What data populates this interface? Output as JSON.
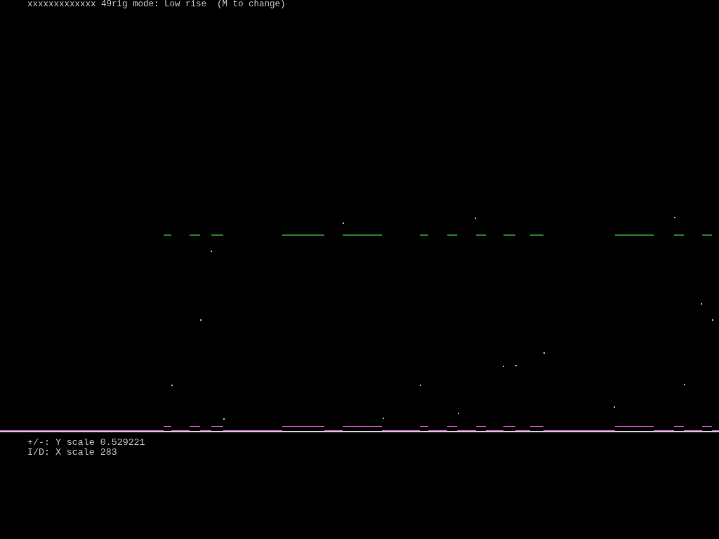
{
  "header": "xxxxxxxxxxxxx 49rig mode: Low rise  (M to change)",
  "footer": [
    "+/-: Y scale 0.529221",
    "I/D: X scale 283"
  ]
}
